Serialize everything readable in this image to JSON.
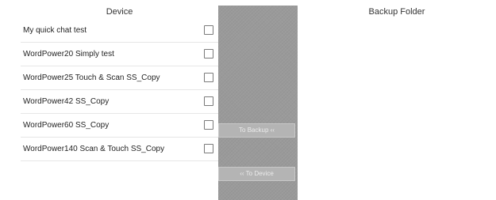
{
  "device_panel": {
    "title": "Device",
    "items": [
      {
        "label": "My quick chat test",
        "checked": false
      },
      {
        "label": "WordPower20 Simply test",
        "checked": false
      },
      {
        "label": "WordPower25 Touch & Scan SS_Copy",
        "checked": false
      },
      {
        "label": "WordPower42 SS_Copy",
        "checked": false
      },
      {
        "label": "WordPower60 SS_Copy",
        "checked": false
      },
      {
        "label": "WordPower140 Scan & Touch SS_Copy",
        "checked": false
      }
    ]
  },
  "transfer": {
    "to_backup_label": "To Backup ‹‹",
    "to_device_label": "‹‹ To Device"
  },
  "backup_panel": {
    "title": "Backup Folder"
  }
}
